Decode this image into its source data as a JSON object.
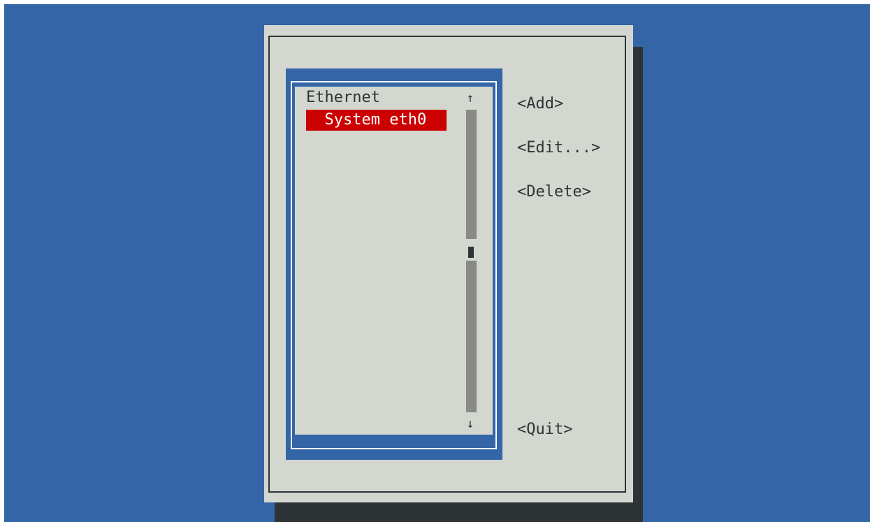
{
  "connection_list": {
    "groups": [
      {
        "label": "Ethernet",
        "items": [
          {
            "label": "  System eth0",
            "selected": true
          }
        ]
      }
    ],
    "scroll_up_glyph": "↑",
    "scroll_down_glyph": "↓"
  },
  "actions": {
    "add": "<Add>",
    "edit": "<Edit...>",
    "delete": "<Delete>",
    "quit": "<Quit>"
  },
  "colors": {
    "background": "#3465a6",
    "dialog": "#d3d7cf",
    "selection": "#cc0000",
    "shadow": "#2e3436"
  }
}
